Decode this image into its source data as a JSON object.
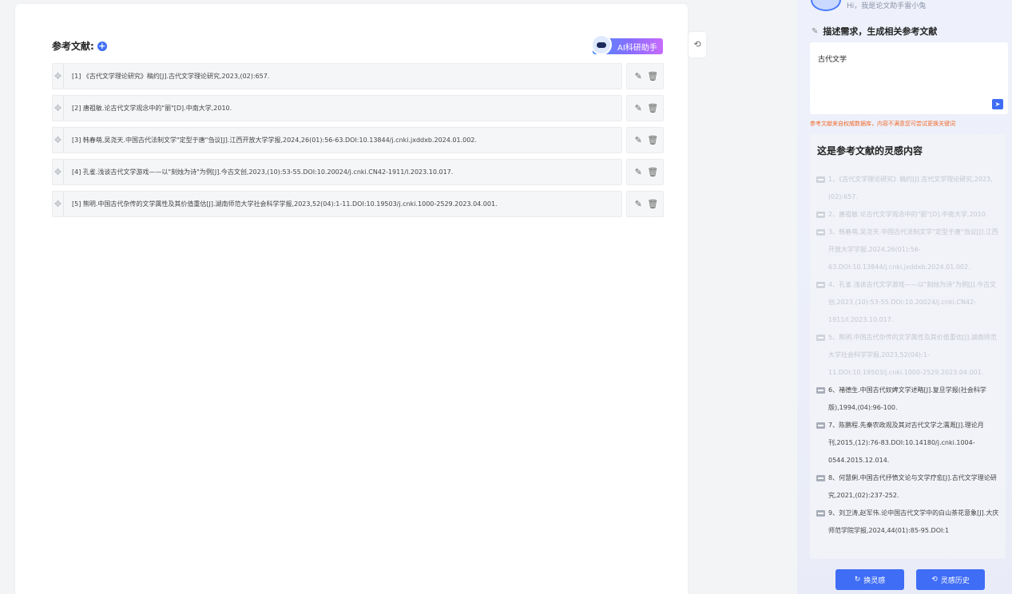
{
  "references": {
    "title": "参考文献:",
    "ai_button": "AI科研助手",
    "items": [
      "[1] 《古代文学理论研究》稿约[J].古代文学理论研究,2023,(02):657.",
      "[2] 唐祖敏.论古代文学观念中的\"丽\"[D].中南大学,2010.",
      "[3] 韩春萌,吴尧天.中国古代法制文学\"定型于唐\"刍议[J].江西开放大学学报,2024,26(01):56-63.DOI:10.13844/j.cnki.jxddxb.2024.01.002.",
      "[4] 孔雀.浅谈古代文学游戏——以\"刻烛为诗\"为例[J].今古文创,2023,(10):53-55.DOI:10.20024/j.cnki.CN42-1911/I.2023.10.017.",
      "[5] 熊明.中国古代杂传的文学属性及其价值重估[J].湖南师范大学社会科学学报,2023,52(04):1-11.DOI:10.19503/j.cnki.1000-2529.2023.04.001."
    ]
  },
  "panel": {
    "greeting": "Hi，我是论文助手雷小兔",
    "need_title": "描述需求，生成相关参考文献",
    "input_value": "古代文学",
    "notice": "参考文献来自权威数据库，内容不满意您可尝试更换关键词",
    "inspiration_title": "这是参考文献的灵感内容",
    "inspiration_items": [
      "1、《古代文学理论研究》稿约[J].古代文学理论研究,2023,(02):657.",
      "2、唐祖敏.论古代文学观念中的\"丽\"[D].中南大学,2010.",
      "3、韩春萌,吴尧天.中国古代法制文学\"定型于唐\"刍议[J].江西开放大学学报,2024,26(01):56-63.DOI:10.13844/j.cnki.jxddxb.2024.01.002.",
      "4、孔雀.浅谈古代文学游戏——以\"刻烛为诗\"为例[J].今古文创,2023,(10):53-55.DOI:10.20024/j.cnki.CN42-1911/I.2023.10.017.",
      "5、熊明.中国古代杂传的文学属性及其价值重估[J].湖南师范大学社会科学学报,2023,52(04):1-11.DOI:10.19503/j.cnki.1000-2529.2023.04.001.",
      "6、褚德生.中国古代奴婢文学述略[J].复旦学报(社会科学版),1994,(04):96-100.",
      "7、陈鹏程.先秦农政观及其对古代文学之濡溉[J].理论月刊,2015,(12):76-83.DOI:10.14180/j.cnki.1004-0544.2015.12.014.",
      "8、何慧俐.中国古代抒愤文论与文学疗愈[J].古代文学理论研究,2021,(02):237-252.",
      "9、刘卫涛,赵军伟.论中国古代文学中的白山茶花意象[J].大庆师范学院学报,2024,44(01):85-95.DOI:1"
    ],
    "change_button": "换灵感",
    "history_button": "灵感历史"
  },
  "colors": {
    "accent": "#3f6df6",
    "notice": "#f06b2e"
  }
}
